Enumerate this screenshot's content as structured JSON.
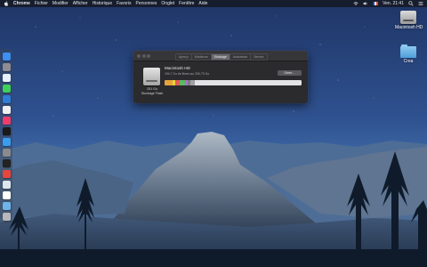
{
  "menubar": {
    "app_name": "Chrome",
    "items": [
      "Fichier",
      "Modifier",
      "Afficher",
      "Historique",
      "Favoris",
      "Personnes",
      "Onglet",
      "Fenêtre",
      "Aide"
    ],
    "clock": "Ven. 21:41"
  },
  "desktop": {
    "icons": [
      {
        "label": "Macintosh HD"
      },
      {
        "label": "Crea"
      }
    ]
  },
  "window": {
    "tabs": [
      "Aperçu",
      "Moniteurs",
      "Stockage",
      "Assistance",
      "Service"
    ],
    "active_tab": 2,
    "disk_name": "Macintosh HD",
    "free_text": "194,7 Go de libres sur 250,79 Go",
    "manage_label": "Gérer…",
    "capacity": "251 Go",
    "capacity_type": "Stockage Flash",
    "storage_segments": [
      {
        "fraction": 0.06,
        "color": "#e8a33d"
      },
      {
        "fraction": 0.02,
        "color": "#e9d33a"
      },
      {
        "fraction": 0.03,
        "color": "#e05a5a"
      },
      {
        "fraction": 0.04,
        "color": "#5fb85f"
      },
      {
        "fraction": 0.02,
        "color": "#b368d9"
      },
      {
        "fraction": 0.02,
        "color": "#7b7b80"
      },
      {
        "fraction": 0.03,
        "color": "#a0a0a4"
      }
    ]
  },
  "dock": {
    "apps": [
      {
        "icon": "finder-icon",
        "color": "#3d8ff0"
      },
      {
        "icon": "launchpad-icon",
        "color": "#8d8d92"
      },
      {
        "icon": "safari-icon",
        "color": "#e8f2ff"
      },
      {
        "icon": "messages-icon",
        "color": "#3fcf5a"
      },
      {
        "icon": "facetime-icon",
        "color": "#2f7dd6"
      },
      {
        "icon": "photos-icon",
        "color": "#f0f0f0"
      },
      {
        "icon": "itunes-icon",
        "color": "#ef3d6b"
      },
      {
        "icon": "apple-tv-icon",
        "color": "#1a1a1a"
      },
      {
        "icon": "app-store-icon",
        "color": "#3a9cf0"
      },
      {
        "icon": "system-preferences-icon",
        "color": "#8a8a8e"
      },
      {
        "icon": "terminal-icon",
        "color": "#222222"
      },
      {
        "icon": "chrome-icon",
        "color": "#e8453c"
      },
      {
        "icon": "preview-icon",
        "color": "#dde6ee"
      },
      {
        "icon": "document-icon",
        "color": "#ffffff"
      },
      {
        "icon": "folder-icon",
        "color": "#6eb4ea"
      },
      {
        "icon": "trash-icon",
        "color": "#b8b8bc"
      }
    ]
  }
}
